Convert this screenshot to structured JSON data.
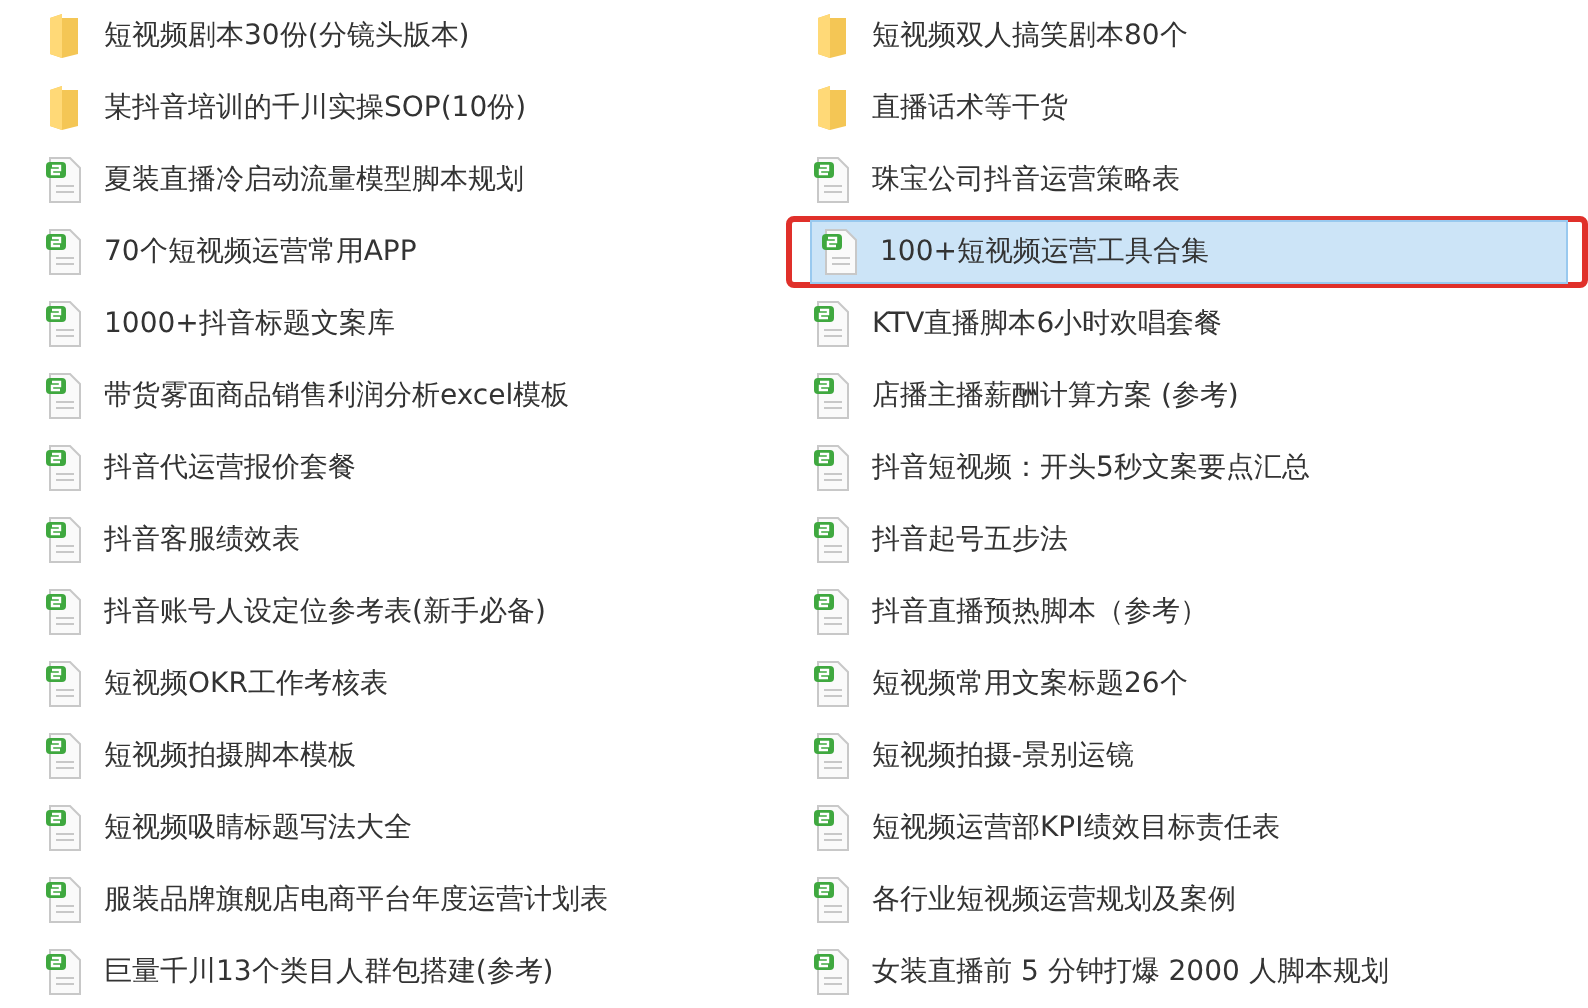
{
  "columns": [
    {
      "items": [
        {
          "kind": "folder",
          "name": "短视频剧本30份(分镜头版本)",
          "selected": false,
          "outlined": false
        },
        {
          "kind": "folder",
          "name": "某抖音培训的千川实操SOP(10份)",
          "selected": false,
          "outlined": false
        },
        {
          "kind": "sheet",
          "name": "夏装直播冷启动流量模型脚本规划",
          "selected": false,
          "outlined": false
        },
        {
          "kind": "sheet",
          "name": "70个短视频运营常用APP",
          "selected": false,
          "outlined": false
        },
        {
          "kind": "sheet",
          "name": "1000+抖音标题文案库",
          "selected": false,
          "outlined": false
        },
        {
          "kind": "sheet",
          "name": "带货雾面商品销售利润分析excel模板",
          "selected": false,
          "outlined": false
        },
        {
          "kind": "sheet",
          "name": "抖音代运营报价套餐",
          "selected": false,
          "outlined": false
        },
        {
          "kind": "sheet",
          "name": "抖音客服绩效表",
          "selected": false,
          "outlined": false
        },
        {
          "kind": "sheet",
          "name": "抖音账号人设定位参考表(新手必备)",
          "selected": false,
          "outlined": false
        },
        {
          "kind": "sheet",
          "name": "短视频OKR工作考核表",
          "selected": false,
          "outlined": false
        },
        {
          "kind": "sheet",
          "name": "短视频拍摄脚本模板",
          "selected": false,
          "outlined": false
        },
        {
          "kind": "sheet",
          "name": "短视频吸睛标题写法大全",
          "selected": false,
          "outlined": false
        },
        {
          "kind": "sheet",
          "name": "服装品牌旗舰店电商平台年度运营计划表",
          "selected": false,
          "outlined": false
        },
        {
          "kind": "sheet",
          "name": "巨量千川13个类目人群包搭建(参考)",
          "selected": false,
          "outlined": false
        }
      ]
    },
    {
      "items": [
        {
          "kind": "folder",
          "name": "短视频双人搞笑剧本80个",
          "selected": false,
          "outlined": false
        },
        {
          "kind": "folder",
          "name": "直播话术等干货",
          "selected": false,
          "outlined": false
        },
        {
          "kind": "sheet",
          "name": "珠宝公司抖音运营策略表",
          "selected": false,
          "outlined": false
        },
        {
          "kind": "sheet",
          "name": "100+短视频运营工具合集",
          "selected": true,
          "outlined": true
        },
        {
          "kind": "sheet",
          "name": "KTV直播脚本6小时欢唱套餐",
          "selected": false,
          "outlined": false
        },
        {
          "kind": "sheet",
          "name": "店播主播薪酬计算方案 (参考)",
          "selected": false,
          "outlined": false
        },
        {
          "kind": "sheet",
          "name": "抖音短视频：开头5秒文案要点汇总",
          "selected": false,
          "outlined": false
        },
        {
          "kind": "sheet",
          "name": "抖音起号五步法",
          "selected": false,
          "outlined": false
        },
        {
          "kind": "sheet",
          "name": "抖音直播预热脚本（参考）",
          "selected": false,
          "outlined": false
        },
        {
          "kind": "sheet",
          "name": "短视频常用文案标题26个",
          "selected": false,
          "outlined": false
        },
        {
          "kind": "sheet",
          "name": "短视频拍摄-景别运镜",
          "selected": false,
          "outlined": false
        },
        {
          "kind": "sheet",
          "name": "短视频运营部KPI绩效目标责任表",
          "selected": false,
          "outlined": false
        },
        {
          "kind": "sheet",
          "name": "各行业短视频运营规划及案例",
          "selected": false,
          "outlined": false
        },
        {
          "kind": "sheet",
          "name": "女装直播前 5 分钟打爆 2000 人脚本规划",
          "selected": false,
          "outlined": false
        }
      ]
    }
  ]
}
